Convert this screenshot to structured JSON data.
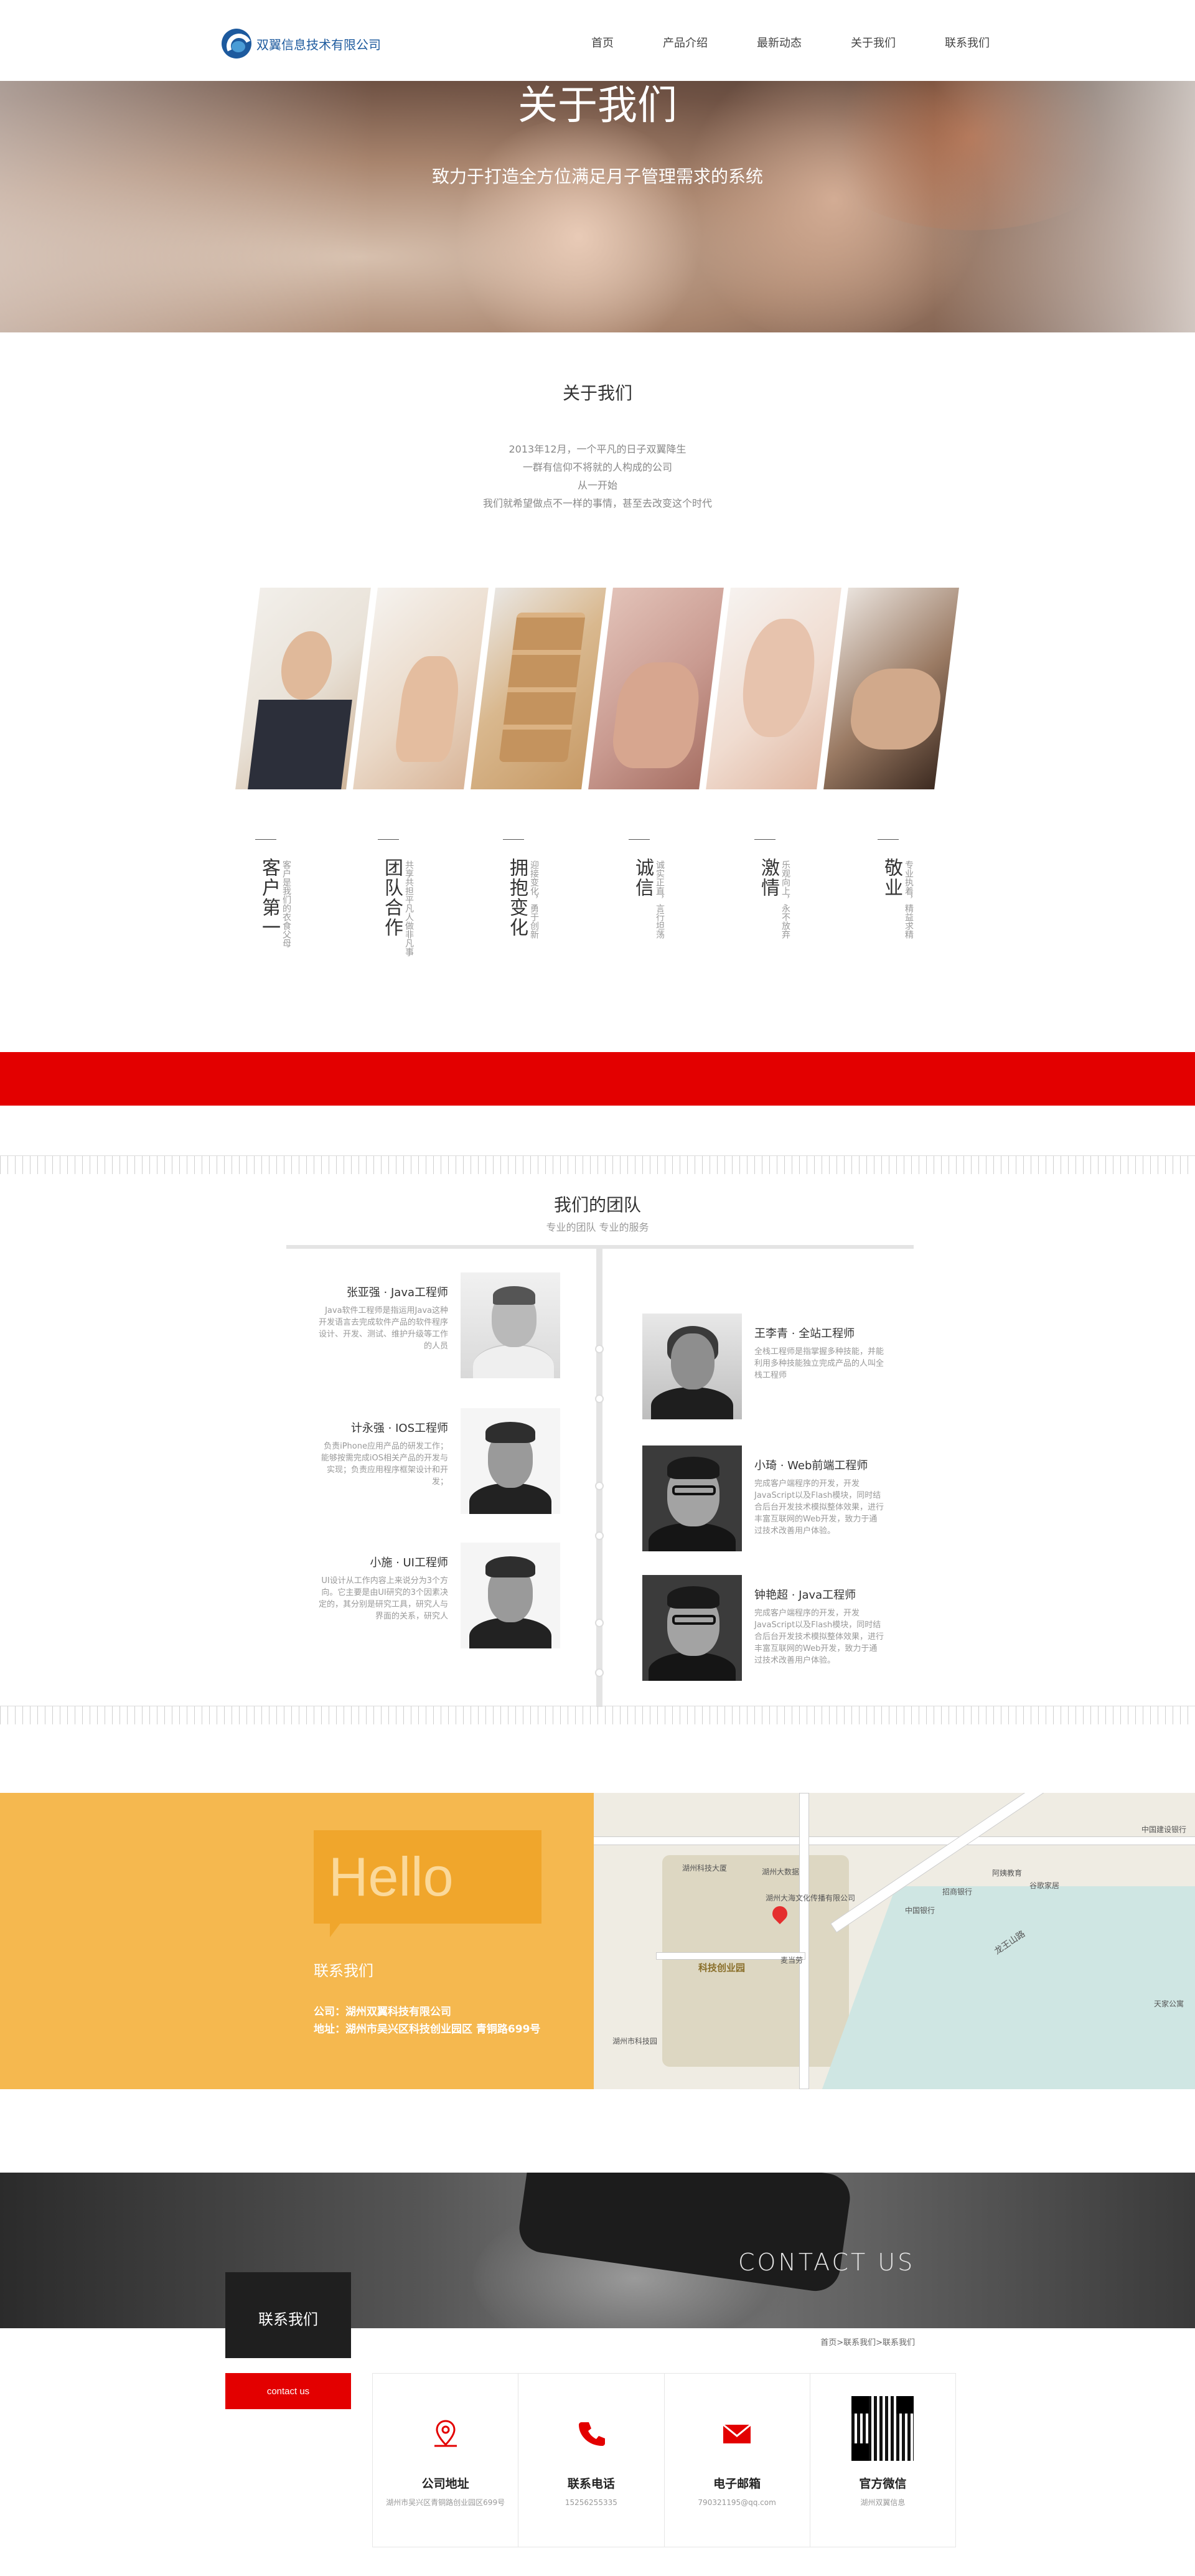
{
  "header": {
    "company": "双翼信息技术有限公司",
    "nav": [
      "首页",
      "产品介绍",
      "最新动态",
      "关于我们",
      "联系我们"
    ]
  },
  "banner": {
    "title": "关于我们",
    "subtitle": "致力于打造全方位满足月子管理需求的系统"
  },
  "about": {
    "title": "关于我们",
    "lines": [
      "2013年12月，一个平凡的日子双翼降生",
      "一群有信仰不将就的人构成的公司",
      "从一开始",
      "我们就希望做点不一样的事情，甚至去改变这个时代"
    ]
  },
  "values": [
    {
      "title": "客户第一",
      "desc": "客户是我们的衣食父母"
    },
    {
      "title": "团队合作",
      "desc": "共享共担平凡人做非凡事"
    },
    {
      "title": "拥抱变化",
      "desc": "迎接变化，勇于创新"
    },
    {
      "title": "诚信",
      "desc": "诚实正直，言行坦荡"
    },
    {
      "title": "激情",
      "desc": "乐观向上，永不放弃"
    },
    {
      "title": "敬业",
      "desc": "专业执着，精益求精"
    }
  ],
  "team": {
    "title": "我们的团队",
    "subtitle": "专业的团队 专业的服务",
    "left": [
      {
        "name": "张亚强 · Java工程师",
        "desc": "Java软件工程师是指运用Java这种开发语言去完成软件产品的软件程序设计、开发、测试、维护升级等工作的人员"
      },
      {
        "name": "计永强 · IOS工程师",
        "desc": "负责iPhone应用产品的研发工作；能够按需完成iOS相关产品的开发与实现；负责应用程序框架设计和开发；"
      },
      {
        "name": "小施 · UI工程师",
        "desc": "UI设计从工作内容上来说分为3个方向。它主要是由UI研究的3个因素决定的，其分别是研究工具，研究人与界面的关系，研究人"
      }
    ],
    "right": [
      {
        "name": "王李青 · 全站工程师",
        "desc": "全栈工程师是指掌握多种技能，并能利用多种技能独立完成产品的人叫全栈工程师"
      },
      {
        "name": "小琦 · Web前端工程师",
        "desc": "完成客户端程序的开发，开发JavaScript以及Flash模块，同时结合后台开发技术模拟整体效果，进行丰富互联网的Web开发，致力于通过技术改善用户体验。"
      },
      {
        "name": "钟艳超 · Java工程师",
        "desc": "完成客户端程序的开发，开发JavaScript以及Flash模块，同时结合后台开发技术模拟整体效果，进行丰富互联网的Web开发，致力于通过技术改善用户体验。"
      }
    ]
  },
  "contact": {
    "hello": "Hello",
    "title": "联系我们",
    "company": "公司：湖州双翼科技有限公司",
    "address": "地址：湖州市吴兴区科技创业园区 青铜路699号"
  },
  "map": {
    "labels": [
      "湖州科技大厦",
      "湖州大数据",
      "湖州大海文化传播有限公司",
      "科技创业园",
      "中国银行",
      "招商银行",
      "阿姨教育",
      "谷歌家居",
      "龙王山路",
      "湖州市科技园",
      "中国建设银行",
      "麦当劳",
      "天家公寓"
    ],
    "pin_label": "科技创业园"
  },
  "contact_us": {
    "banner_text": "CONTACT US",
    "box_title": "联系我们",
    "button": "contact us",
    "breadcrumb": "首页>联系我们>联系我们",
    "cards": [
      {
        "title": "公司地址",
        "desc": "湖州市吴兴区青铜路创业园区699号",
        "icon": "map-pin-icon"
      },
      {
        "title": "联系电话",
        "desc": "15256255335",
        "icon": "phone-icon"
      },
      {
        "title": "电子邮箱",
        "desc": "790321195@qq.com",
        "icon": "mail-icon"
      },
      {
        "title": "官方微信",
        "desc": "湖州双翼信息",
        "icon": "qr-code-icon"
      }
    ]
  },
  "colors": {
    "accent_red": "#e30000",
    "brand_blue": "#1d5a9e",
    "contact_yellow": "#f5b84f",
    "hello_orange": "#f0a62c"
  }
}
